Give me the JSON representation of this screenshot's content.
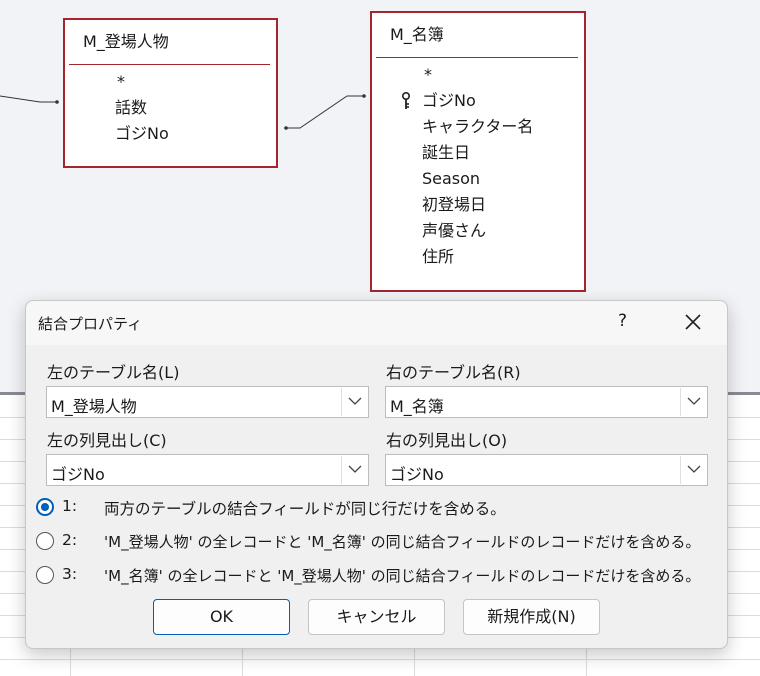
{
  "design_view": {
    "tables": [
      {
        "name": "M_登場人物",
        "fields": [
          "*",
          "話数",
          "ゴジNo"
        ]
      },
      {
        "name": "M_名簿",
        "fields": [
          "*",
          "ゴジNo",
          "キャラクター名",
          "誕生日",
          "Season",
          "初登場日",
          "声優さん",
          "住所"
        ],
        "key_field": "ゴジNo"
      }
    ]
  },
  "dialog": {
    "title": "結合プロパティ",
    "help": "?",
    "left_table_label": "左のテーブル名(L)",
    "left_table_value": "M_登場人物",
    "right_table_label": "右のテーブル名(R)",
    "right_table_value": "M_名簿",
    "left_column_label": "左の列見出し(C)",
    "left_column_value": "ゴジNo",
    "right_column_label": "右の列見出し(O)",
    "right_column_value": "ゴジNo",
    "options": [
      {
        "num": "1:",
        "text": "両方のテーブルの結合フィールドが同じ行だけを含める。",
        "selected": true
      },
      {
        "num": "2:",
        "text": "'M_登場人物' の全レコードと 'M_名簿' の同じ結合フィールドのレコードだけを含める。",
        "selected": false
      },
      {
        "num": "3:",
        "text": "'M_名簿' の全レコードと 'M_登場人物' の同じ結合フィールドのレコードだけを含める。",
        "selected": false
      }
    ],
    "buttons": {
      "ok": "OK",
      "cancel": "キャンセル",
      "new": "新規作成(N)"
    }
  },
  "colors": {
    "table_border": "#a4262c",
    "accent": "#005fb8"
  }
}
